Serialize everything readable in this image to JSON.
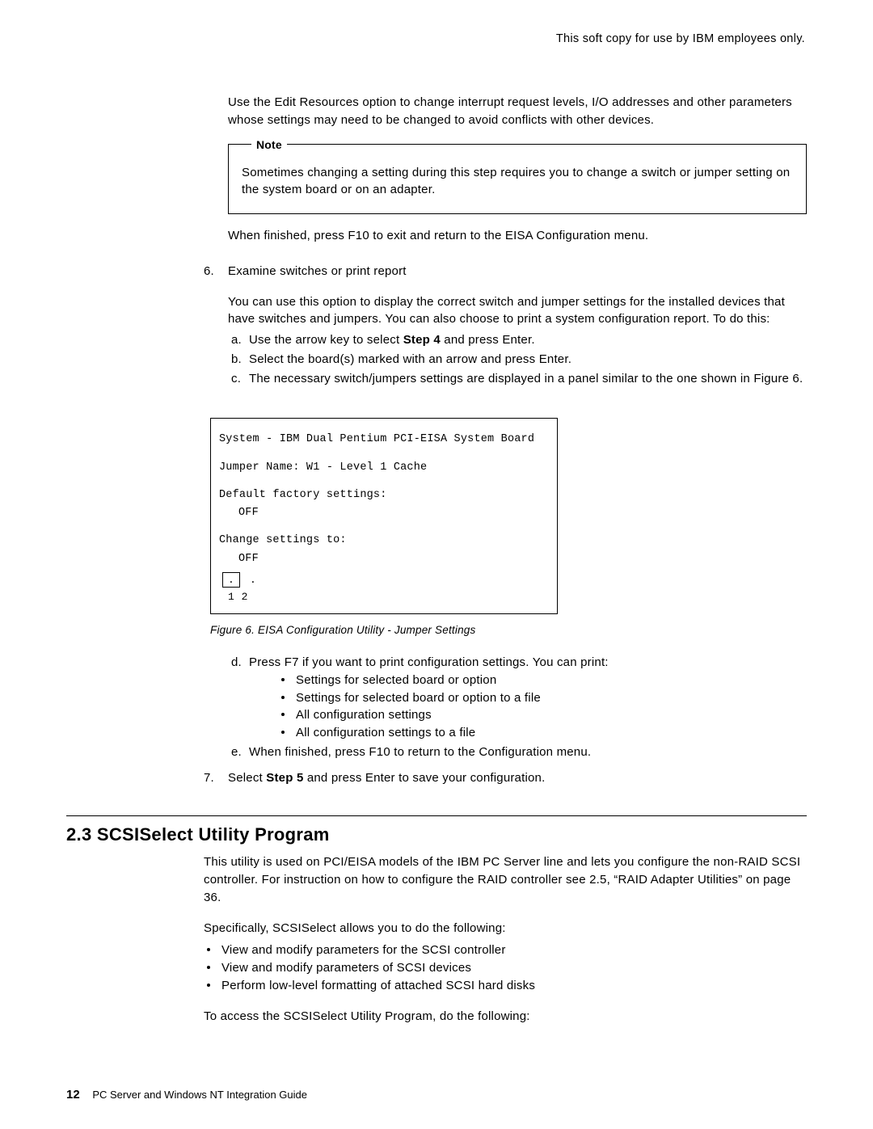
{
  "header": {
    "confidential": "This soft copy for use by IBM employees only."
  },
  "intro_para": "Use the Edit Resources option to change interrupt request levels, I/O addresses and other parameters whose settings may need to be changed to avoid conflicts with other devices.",
  "note": {
    "label": "Note",
    "text": "Sometimes changing a setting during this step requires you to change a switch or jumper setting on the system board or on an adapter."
  },
  "after_note": "When finished, press F10 to exit and return to the EISA Configuration menu.",
  "step6": {
    "num": "6.",
    "title": "Examine switches or print report",
    "desc": "You can use this option to display the correct switch and jumper settings for the installed devices that have switches and jumpers.  You can also choose to print a system configuration report.  To do this:",
    "a_pre": "Use the arrow key to select ",
    "a_bold": "Step 4",
    "a_post": " and press Enter.",
    "b": "Select the board(s) marked with an arrow and press Enter.",
    "c": "The necessary switch/jumpers settings are displayed in a panel similar to the one shown in Figure  6.",
    "fig": {
      "sys_line": "System - IBM Dual Pentium PCI-EISA System Board",
      "jumper_line": "Jumper Name:  W1 - Level 1 Cache",
      "default_label": "Default factory settings:",
      "default_val": "OFF",
      "change_label": "Change settings to:",
      "change_val": "OFF",
      "pins_label": "1    2"
    },
    "caption": "Figure  6.  EISA Configuration Utility - Jumper Settings",
    "d": {
      "intro": "Press F7 if you want to print configuration settings.  You can print:",
      "items": [
        "Settings for selected board or option",
        "Settings for selected board or option to a file",
        "All configuration settings",
        "All configuration settings to a file"
      ]
    },
    "e": "When finished, press F10 to return to the Configuration menu."
  },
  "step7": {
    "num": "7.",
    "pre": "Select ",
    "bold": "Step 5",
    "post": " and press Enter to save your configuration."
  },
  "section23": {
    "heading": "2.3  SCSISelect Utility Program",
    "p1": "This utility is used on PCI/EISA models of the IBM PC Server line and lets you configure the non-RAID SCSI controller.  For instruction on how to configure the RAID controller see 2.5, “RAID Adapter Utilities” on page  36.",
    "p2": "Specifically, SCSISelect allows you to do the following:",
    "bullets": [
      "View and modify parameters for the SCSI controller",
      "View and modify parameters of SCSI devices",
      "Perform low-level formatting of attached SCSI hard disks"
    ],
    "p3": "To access the SCSISelect Utility Program, do the following:"
  },
  "footer": {
    "page": "12",
    "title": "PC Server and Windows NT Integration Guide"
  }
}
